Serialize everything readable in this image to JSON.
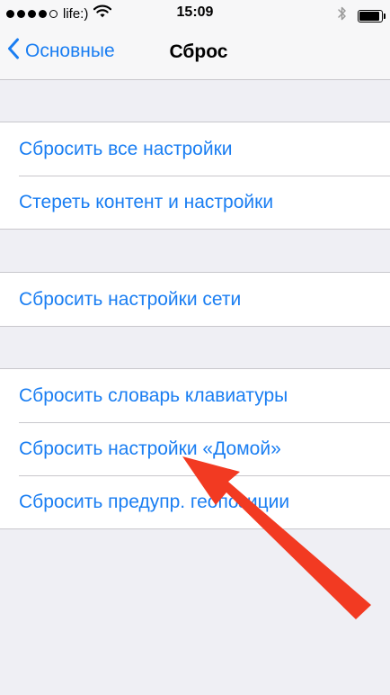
{
  "status_bar": {
    "carrier": "life:)",
    "time": "15:09",
    "signal_bars_filled": 4,
    "signal_bars_total": 5,
    "battery_level": 0.85
  },
  "nav": {
    "back_label": "Основные",
    "title": "Сброс"
  },
  "groups": [
    {
      "items": [
        "Сбросить все настройки",
        "Стереть контент и настройки"
      ]
    },
    {
      "items": [
        "Сбросить настройки сети"
      ]
    },
    {
      "items": [
        "Сбросить словарь клавиатуры",
        "Сбросить настройки «Домой»",
        "Сбросить предупр. геопозиции"
      ]
    }
  ],
  "colors": {
    "accent": "#1a7ef2",
    "background": "#efeff4",
    "annotation_arrow": "#f23a22"
  },
  "icons": {
    "wifi": "wifi-icon",
    "bluetooth": "bluetooth-icon",
    "battery": "battery-icon",
    "back": "chevron-left-icon"
  }
}
